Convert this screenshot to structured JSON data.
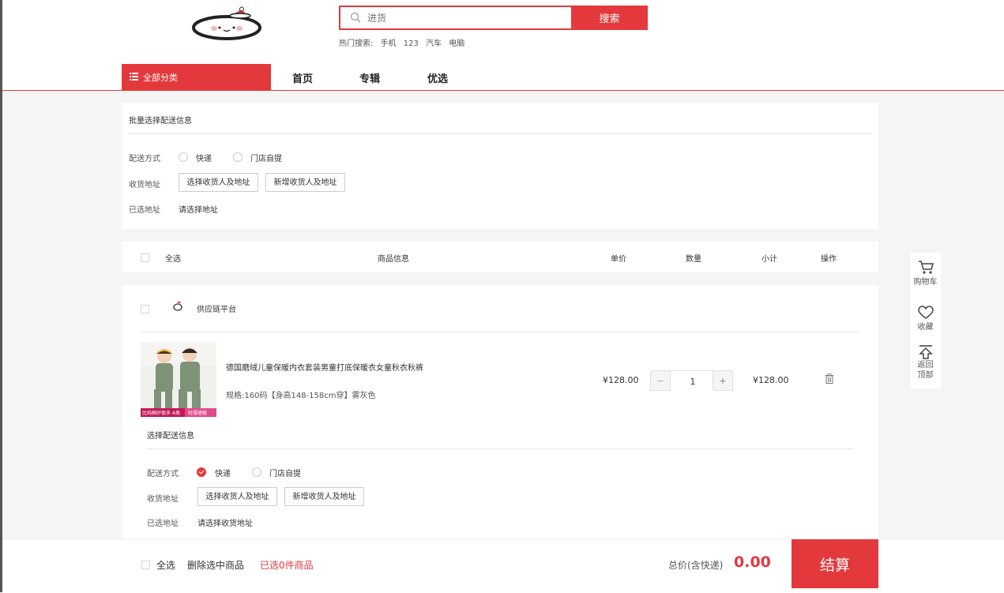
{
  "header": {
    "search": {
      "placeholder": "进货",
      "button": "搜索"
    },
    "hot_search": {
      "label": "热门搜索:",
      "items": [
        "手机",
        "123",
        "汽车",
        "电脑"
      ]
    },
    "category_button": "全部分类",
    "nav": [
      "首页",
      "专辑",
      "优选"
    ]
  },
  "batch": {
    "title": "批量选择配送信息",
    "delivery_label": "配送方式",
    "delivery_options": [
      "快递",
      "门店自提"
    ],
    "address_label": "收货地址",
    "choose_address": "选择收货人及地址",
    "add_address": "新增收货人及地址",
    "selected_label": "已选地址",
    "selected_value": "请选择地址"
  },
  "table_header": {
    "select_all": "全选",
    "info": "商品信息",
    "price": "单价",
    "quantity": "数量",
    "subtotal": "小计",
    "action": "操作"
  },
  "shop": {
    "name": "供应链平台"
  },
  "product": {
    "title": "德国磨绒儿童保暖内衣套装男童打底保暖衣女童秋衣秋裤",
    "spec": "规格:160码【身高148-158cm穿】雾灰色",
    "image_banner": "比纯棉好很多 A类",
    "image_tag": "轻薄速暖",
    "price": "¥128.00",
    "quantity": "1",
    "subtotal": "¥128.00",
    "minus": "−",
    "plus": "+"
  },
  "item_delivery": {
    "title": "选择配送信息",
    "delivery_label": "配送方式",
    "delivery_options": [
      "快递",
      "门店自提"
    ],
    "address_label": "收货地址",
    "choose_address": "选择收货人及地址",
    "add_address": "新增收货人及地址",
    "selected_label": "已选地址",
    "selected_value": "请选择收货地址"
  },
  "sidebar": {
    "cart": "购物车",
    "favorites": "收藏",
    "back_top": "返回顶部"
  },
  "footer": {
    "select_all": "全选",
    "delete_selected": "删除选中商品",
    "selected_count": "已选0件商品",
    "total_label": "总价(含快递)",
    "total_value": "0.00",
    "checkout": "结算"
  },
  "colors": {
    "accent": "#e4393c",
    "background": "#f5f5f5",
    "text": "#333333"
  }
}
